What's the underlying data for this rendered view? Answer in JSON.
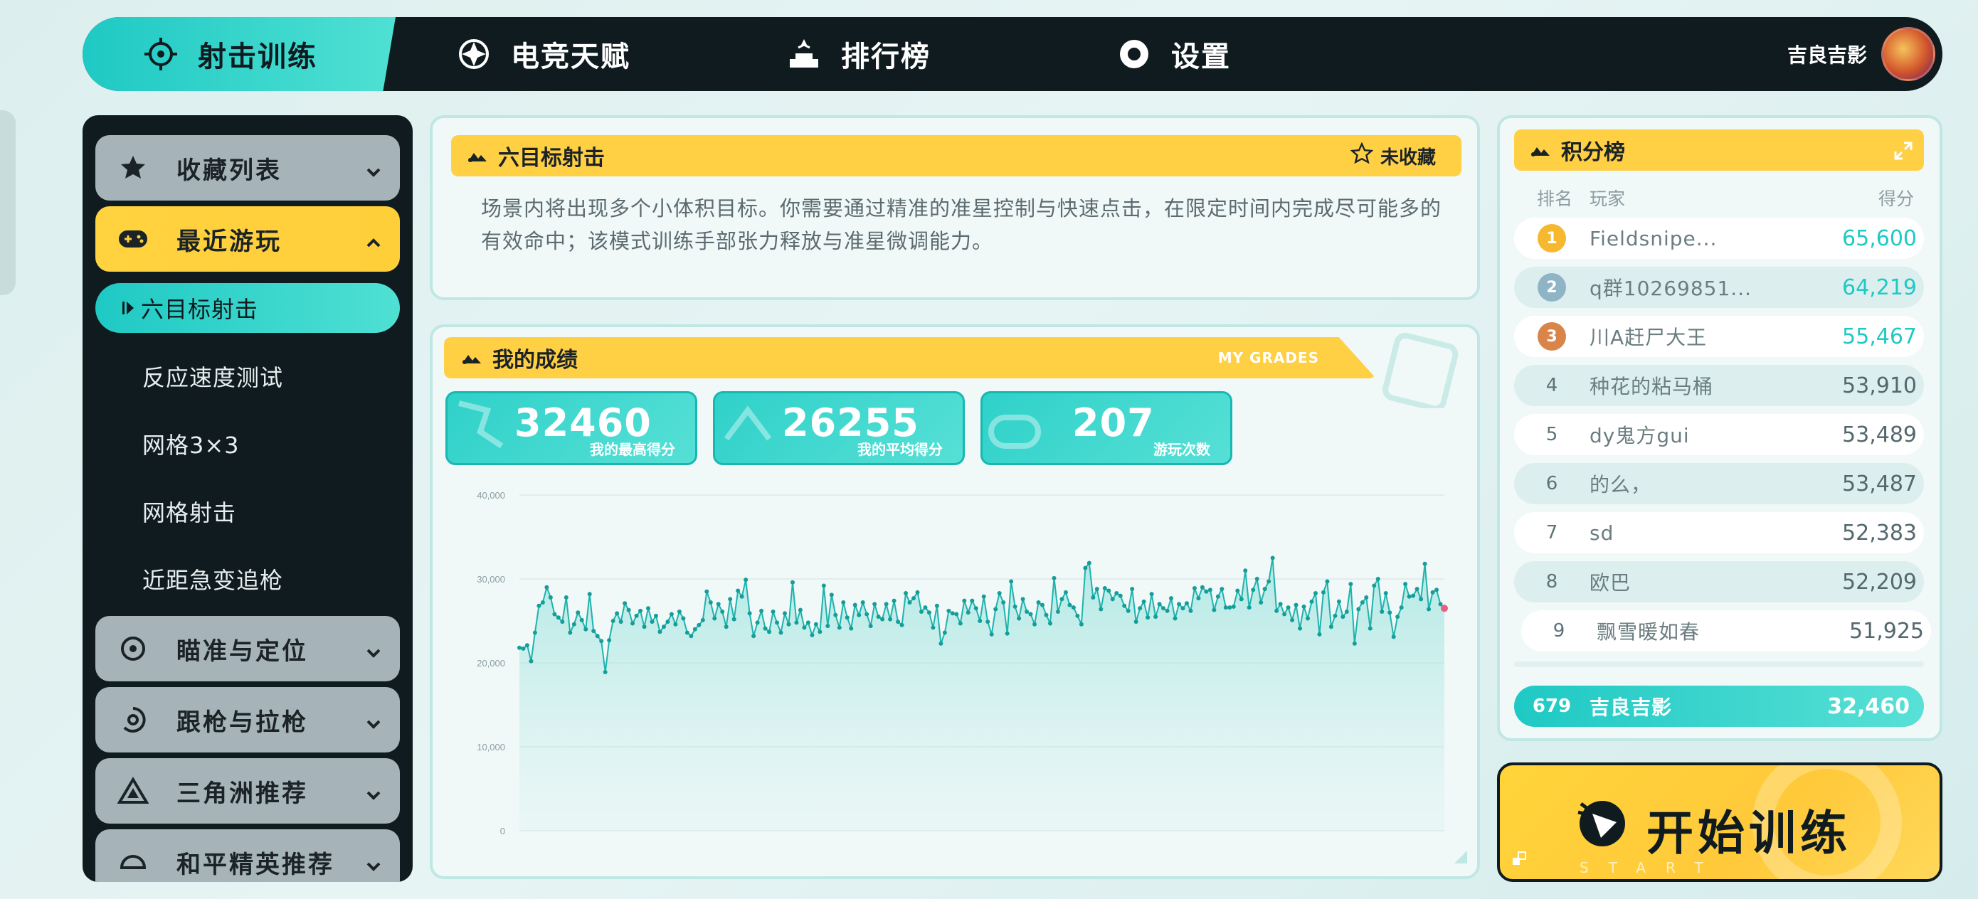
{
  "nav": {
    "items": [
      {
        "label": "射击训练",
        "icon": "crosshair-icon"
      },
      {
        "label": "电竞天赋",
        "icon": "talent-icon"
      },
      {
        "label": "排行榜",
        "icon": "ranking-icon"
      },
      {
        "label": "设置",
        "icon": "gear-icon"
      }
    ],
    "username": "吉良吉影"
  },
  "sidebar": {
    "categories": [
      {
        "label": "收藏列表",
        "icon": "star-icon"
      },
      {
        "label": "最近游玩",
        "icon": "gamepad-icon"
      },
      {
        "label": "瞄准与定位",
        "icon": "target-icon"
      },
      {
        "label": "跟枪与拉枪",
        "icon": "tracking-icon"
      },
      {
        "label": "三角洲推荐",
        "icon": "delta-icon"
      },
      {
        "label": "和平精英推荐",
        "icon": "helmet-icon"
      }
    ],
    "recent": [
      "六目标射击",
      "反应速度测试",
      "网格3×3",
      "网格射击",
      "近距急变追枪"
    ]
  },
  "mode": {
    "title": "六目标射击",
    "favorite_label": "未收藏",
    "description": "场景内将出现多个小体积目标。你需要通过精准的准星控制与快速点击，在限定时间内完成尽可能多的有效命中；该模式训练手部张力释放与准星微调能力。"
  },
  "grades": {
    "title": "我的成绩",
    "subtitle": "MY GRADES",
    "stats": [
      {
        "value": "32460",
        "label": "我的最高得分"
      },
      {
        "value": "26255",
        "label": "我的平均得分"
      },
      {
        "value": "207",
        "label": "游玩次数"
      }
    ]
  },
  "chart_data": {
    "type": "line",
    "ylim": [
      0,
      40000
    ],
    "yticks": [
      "0",
      "10,000",
      "20,000",
      "30,000",
      "40,000"
    ],
    "series": [
      {
        "values": [
          21800,
          21700,
          22100,
          20200,
          23600,
          26800,
          27200,
          29000,
          27800,
          25800,
          25400,
          24900,
          27800,
          23600,
          24600,
          26000,
          25100,
          24000,
          28200,
          23800,
          23200,
          22600,
          18900,
          22700,
          25000,
          25900,
          24900,
          27100,
          26300,
          24700,
          25600,
          26200,
          24300,
          26500,
          24900,
          25600,
          23700,
          24300,
          24900,
          25800,
          24600,
          26100,
          25300,
          23600,
          23200,
          24000,
          24500,
          25100,
          28500,
          27200,
          25300,
          27000,
          26100,
          24300,
          27600,
          25200,
          28600,
          27900,
          29900,
          25900,
          23200,
          24800,
          26200,
          24100,
          23700,
          26100,
          24800,
          23600,
          25900,
          24600,
          29600,
          24800,
          26300,
          24200,
          24800,
          23300,
          24600,
          23700,
          29200,
          24400,
          28100,
          25700,
          24200,
          27200,
          25400,
          24100,
          26900,
          25700,
          27200,
          25800,
          24400,
          27000,
          25500,
          25200,
          27000,
          25200,
          27400,
          24900,
          24500,
          28300,
          27200,
          27700,
          28400,
          26100,
          26600,
          26000,
          24200,
          26800,
          22300,
          23600,
          26200,
          25900,
          25800,
          24700,
          27400,
          26000,
          27400,
          26500,
          25000,
          27900,
          24900,
          23400,
          26400,
          28300,
          27200,
          23500,
          29700,
          26700,
          25300,
          27600,
          26100,
          25800,
          24600,
          27200,
          26900,
          25700,
          24700,
          30100,
          26100,
          27600,
          28400,
          26900,
          26600,
          25600,
          24600,
          31300,
          31900,
          27800,
          28800,
          26400,
          28900,
          28600,
          27600,
          28300,
          28000,
          26800,
          26200,
          28800,
          24900,
          26500,
          27300,
          25400,
          28200,
          25500,
          27000,
          26500,
          26200,
          27700,
          25300,
          27000,
          26500,
          27100,
          26200,
          28900,
          27700,
          29000,
          28500,
          28700,
          26300,
          27900,
          28800,
          26600,
          26600,
          26700,
          28600,
          27600,
          31000,
          26600,
          28700,
          30000,
          27200,
          28800,
          29700,
          32500,
          26200,
          27000,
          25800,
          26600,
          25100,
          26900,
          24100,
          26700,
          25300,
          27300,
          28300,
          23400,
          28400,
          29700,
          24300,
          25600,
          27300,
          25500,
          26100,
          29400,
          22300,
          26400,
          27200,
          27800,
          24100,
          29200,
          30000,
          26100,
          28300,
          26000,
          23100,
          25500,
          26600,
          29400,
          27900,
          28000,
          28800,
          27600,
          31800,
          26400,
          28400,
          28700,
          27000,
          26500
        ]
      }
    ]
  },
  "leaderboard": {
    "title": "积分榜",
    "headers": {
      "rank": "排名",
      "player": "玩家",
      "score": "得分"
    },
    "rows": [
      {
        "rank": "1",
        "name": "Fieldsnipe...",
        "score": "65,600"
      },
      {
        "rank": "2",
        "name": "q群10269851...",
        "score": "64,219"
      },
      {
        "rank": "3",
        "name": "川A赶尸大王",
        "score": "55,467"
      },
      {
        "rank": "4",
        "name": "种花的粘马桶",
        "score": "53,910"
      },
      {
        "rank": "5",
        "name": "dy鬼方gui",
        "score": "53,489"
      },
      {
        "rank": "6",
        "name": "的么，",
        "score": "53,487"
      },
      {
        "rank": "7",
        "name": "sd",
        "score": "52,383"
      },
      {
        "rank": "8",
        "name": "欧巴",
        "score": "52,209"
      },
      {
        "rank": "9",
        "name": "飘雪暖如春",
        "score": "51,925"
      }
    ],
    "me": {
      "rank": "679",
      "name": "吉良吉影",
      "score": "32,460"
    }
  },
  "start": {
    "label": "开始训练",
    "sub": "START TRAINING"
  },
  "colors": {
    "accent": "#1fc9c4",
    "yellow": "#ffcf44",
    "dark": "#0f1b1e",
    "gold": "#f5b82e",
    "silver": "#8fb4c6",
    "bronze": "#d9854a"
  }
}
